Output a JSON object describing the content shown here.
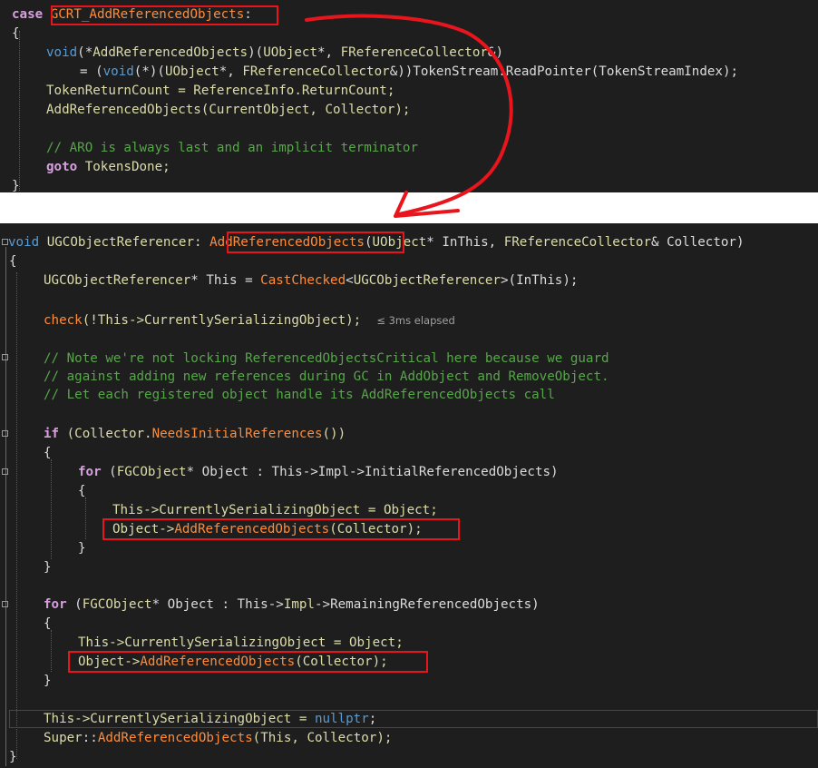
{
  "top_code": {
    "line1": {
      "kw": "case",
      "label": "GCRT_AddReferencedObjects",
      "colon": ":"
    },
    "line2": {
      "brace": "{"
    },
    "line3": {
      "void": "void",
      "p1": "(*",
      "name": "AddReferencedObjects",
      "p2": ")(",
      "t1": "UObject",
      "p3": "*, ",
      "t2": "FReferenceCollector",
      "p4": "&)"
    },
    "line4": {
      "p1": "= (",
      "void": "void",
      "p2": "(*)(",
      "t1": "UObject",
      "p3": "*, ",
      "t2": "FReferenceCollector",
      "p4": "&))TokenStream.ReadPointer(TokenStreamIndex);"
    },
    "line5": {
      "text": "TokenReturnCount = ReferenceInfo.ReturnCount;"
    },
    "line6": {
      "text": "AddReferencedObjects(CurrentObject, Collector);"
    },
    "line7": {
      "comment": "// ARO is always last and an implicit terminator"
    },
    "line8": {
      "kw": "goto",
      "text": " TokensDone;"
    },
    "line9": {
      "brace": "}"
    }
  },
  "bottom_code": {
    "sig": {
      "void": "void",
      "cls": "UGCObjectReferencer",
      "sep": ": ",
      "name": "AddReferencedObjects",
      "p1": "(",
      "t1": "UObject",
      "p2": "* InThis, ",
      "t2": "FReferenceCollector",
      "p3": "& Collector)"
    },
    "open": "{",
    "l_this": {
      "t": "UGCObjectReferencer",
      "p1": "* This = ",
      "fn": "CastChecked",
      "p2": "<",
      "t2": "UGCObjectReferencer",
      "p3": ">(InThis);"
    },
    "l_check": {
      "fn": "check",
      "p1": "(!This->CurrentlySerializingObject);",
      "hint": "≤ 3ms elapsed"
    },
    "c1": "// Note we're not locking ReferencedObjectsCritical here because we guard",
    "c2": "// against adding new references during GC in AddObject and RemoveObject.",
    "c3": "// Let each registered object handle its AddReferencedObjects call",
    "l_if": {
      "kw": "if",
      "p1": " (Collector.",
      "fn": "NeedsInitialReferences",
      "p2": "())"
    },
    "b_open1": "{",
    "l_for1": {
      "kw": "for",
      "p1": " (",
      "t": "FGCObject",
      "p2": "* Object : This->Impl->InitialReferencedObjects)"
    },
    "b_open2": "{",
    "l_assign1": "This->CurrentlySerializingObject = Object;",
    "l_call1": {
      "p1": "Object->",
      "fn": "AddReferencedObjects",
      "p2": "(Collector);"
    },
    "b_close2": "}",
    "b_close1": "}",
    "l_for2": {
      "kw": "for",
      "p1": " (",
      "t": "FGCObject",
      "p2": "* Object : This->",
      "impl": "Impl",
      "p3": "->RemainingReferencedObjects)"
    },
    "b_open3": "{",
    "l_assign2": "This->CurrentlySerializingObject = Object;",
    "l_call2": {
      "p1": "Object->",
      "fn": "AddReferencedObjects",
      "p2": "(Collector);"
    },
    "b_close3": "}",
    "l_null": {
      "p1": "This->CurrentlySerializingObject = ",
      "kw": "nullptr",
      "p2": ";"
    },
    "l_super": {
      "cls": "Super",
      "p1": "::",
      "fn": "AddReferencedObjects",
      "p2": "(This, Collector);"
    },
    "close": "}"
  },
  "colors": {
    "background": "#1e1e1e",
    "highlight_box": "#e8151d",
    "arrow": "#e8151d",
    "keyword": "#569cd6",
    "type": "#4ec9b0",
    "function": "#ff8c3a",
    "comment": "#57a64a"
  }
}
